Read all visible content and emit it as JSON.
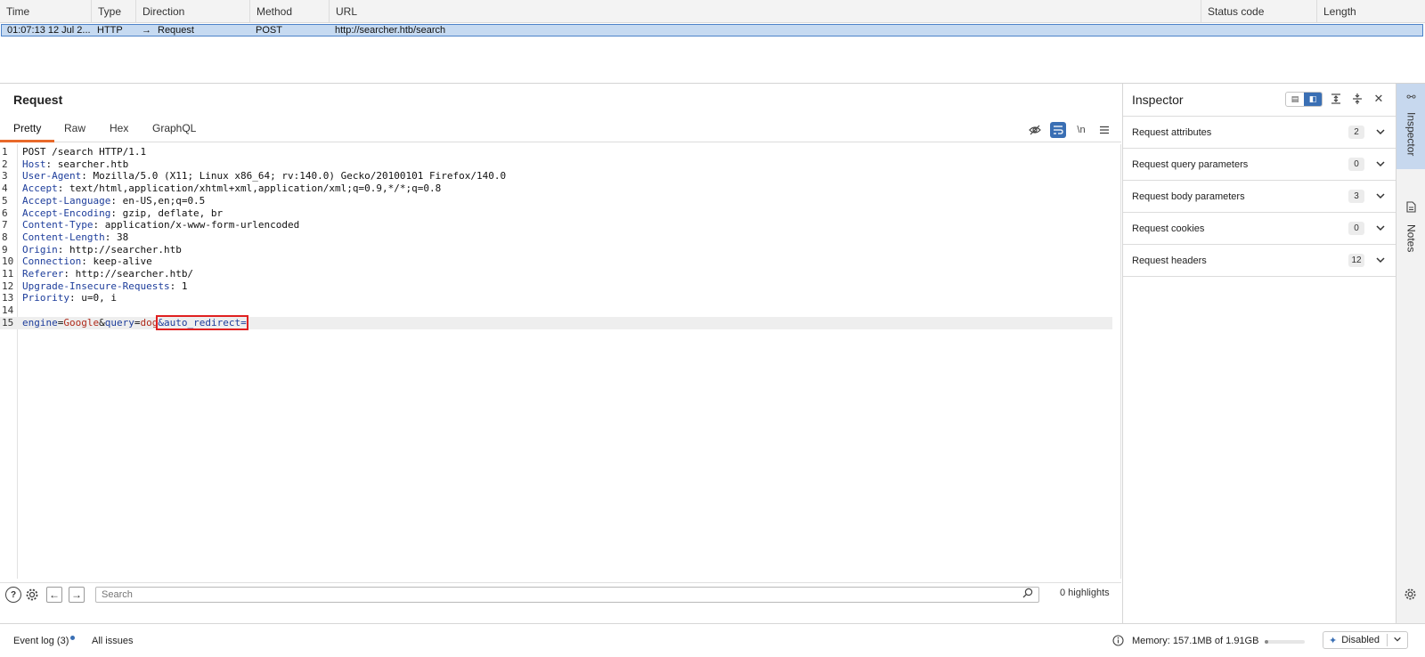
{
  "history": {
    "columns": [
      "Time",
      "Type",
      "Direction",
      "Method",
      "URL",
      "Status code",
      "Length"
    ],
    "row": {
      "time": "01:07:13 12 Jul 2...",
      "type": "HTTP",
      "direction_arrow": "→",
      "direction": "Request",
      "method": "POST",
      "url": "http://searcher.htb/search",
      "status": "",
      "length": ""
    }
  },
  "request": {
    "title": "Request",
    "tabs": [
      "Pretty",
      "Raw",
      "Hex",
      "GraphQL"
    ],
    "active_tab": "Pretty",
    "newline_label": "\\n",
    "lines": [
      {
        "n": "1",
        "type": "plain",
        "text": "POST /search HTTP/1.1"
      },
      {
        "n": "2",
        "type": "header",
        "key": "Host",
        "value": " searcher.htb"
      },
      {
        "n": "3",
        "type": "header",
        "key": "User-Agent",
        "value": " Mozilla/5.0 (X11; Linux x86_64; rv:140.0) Gecko/20100101 Firefox/140.0"
      },
      {
        "n": "4",
        "type": "header",
        "key": "Accept",
        "value": " text/html,application/xhtml+xml,application/xml;q=0.9,*/*;q=0.8"
      },
      {
        "n": "5",
        "type": "header",
        "key": "Accept-Language",
        "value": " en-US,en;q=0.5"
      },
      {
        "n": "6",
        "type": "header",
        "key": "Accept-Encoding",
        "value": " gzip, deflate, br"
      },
      {
        "n": "7",
        "type": "header",
        "key": "Content-Type",
        "value": " application/x-www-form-urlencoded"
      },
      {
        "n": "8",
        "type": "header",
        "key": "Content-Length",
        "value": " 38"
      },
      {
        "n": "9",
        "type": "header",
        "key": "Origin",
        "value": " http://searcher.htb"
      },
      {
        "n": "10",
        "type": "header",
        "key": "Connection",
        "value": " keep-alive"
      },
      {
        "n": "11",
        "type": "header",
        "key": "Referer",
        "value": " http://searcher.htb/"
      },
      {
        "n": "12",
        "type": "header",
        "key": "Upgrade-Insecure-Requests",
        "value": " 1"
      },
      {
        "n": "13",
        "type": "header",
        "key": "Priority",
        "value": " u=0, i"
      },
      {
        "n": "14",
        "type": "plain",
        "text": ""
      },
      {
        "n": "15",
        "type": "body"
      }
    ],
    "body": {
      "k1": "engine",
      "eq1": "=",
      "v1": "Google",
      "amp1": "&",
      "k2": "query",
      "eq2": "=",
      "v2": "dog",
      "highlighted": "&auto_redirect="
    },
    "search_placeholder": "Search",
    "highlights": "0 highlights"
  },
  "inspector": {
    "title": "Inspector",
    "items": [
      {
        "label": "Request attributes",
        "count": "2"
      },
      {
        "label": "Request query parameters",
        "count": "0"
      },
      {
        "label": "Request body parameters",
        "count": "3"
      },
      {
        "label": "Request cookies",
        "count": "0"
      },
      {
        "label": "Request headers",
        "count": "12"
      }
    ]
  },
  "side_tabs": [
    "Inspector",
    "Notes"
  ],
  "status": {
    "event_log": "Event log (3)",
    "all_issues": "All issues",
    "memory": "Memory: 157.1MB of 1.91GB",
    "memory_fraction": 0.08,
    "ai_status": "Disabled"
  },
  "colors": {
    "accent": "#3a6fb4",
    "tab_underline": "#e8692a",
    "selection": "#c6daf1",
    "highlight_box": "#e02020"
  }
}
